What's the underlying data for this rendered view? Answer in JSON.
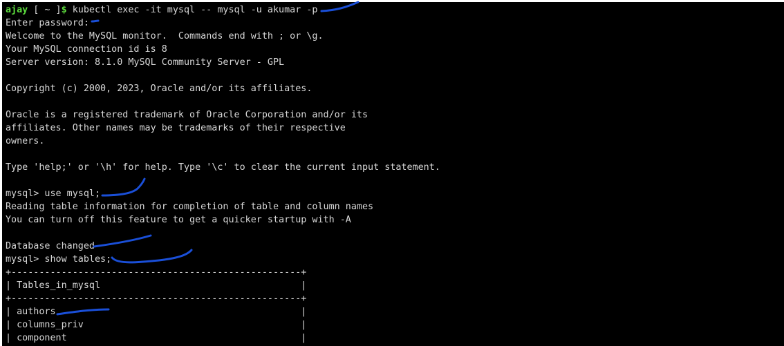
{
  "terminal": {
    "background": "#000000",
    "text_color": "#d8d8d8",
    "prompt_color": "#5ede3e",
    "annotation_color": "#1a4fd8",
    "prompt": {
      "user": "ajay",
      "dir": " [ ~ ]",
      "sign": "$",
      "command": " kubectl exec -it mysql -- mysql -u akumar -p"
    },
    "lines": [
      "Enter password:",
      "Welcome to the MySQL monitor.  Commands end with ; or \\g.",
      "Your MySQL connection id is 8",
      "Server version: 8.1.0 MySQL Community Server - GPL",
      "",
      "Copyright (c) 2000, 2023, Oracle and/or its affiliates.",
      "",
      "Oracle is a registered trademark of Oracle Corporation and/or its",
      "affiliates. Other names may be trademarks of their respective",
      "owners.",
      "",
      "Type 'help;' or '\\h' for help. Type '\\c' to clear the current input statement.",
      "",
      "mysql> use mysql;",
      "Reading table information for completion of table and column names",
      "You can turn off this feature to get a quicker startup with -A",
      "",
      "Database changed",
      "mysql> show tables;",
      "+----------------------------------------------------+",
      "| Tables_in_mysql                                    |",
      "+----------------------------------------------------+",
      "| authors                                            |",
      "| columns_priv                                       |",
      "| component                                          |"
    ]
  }
}
